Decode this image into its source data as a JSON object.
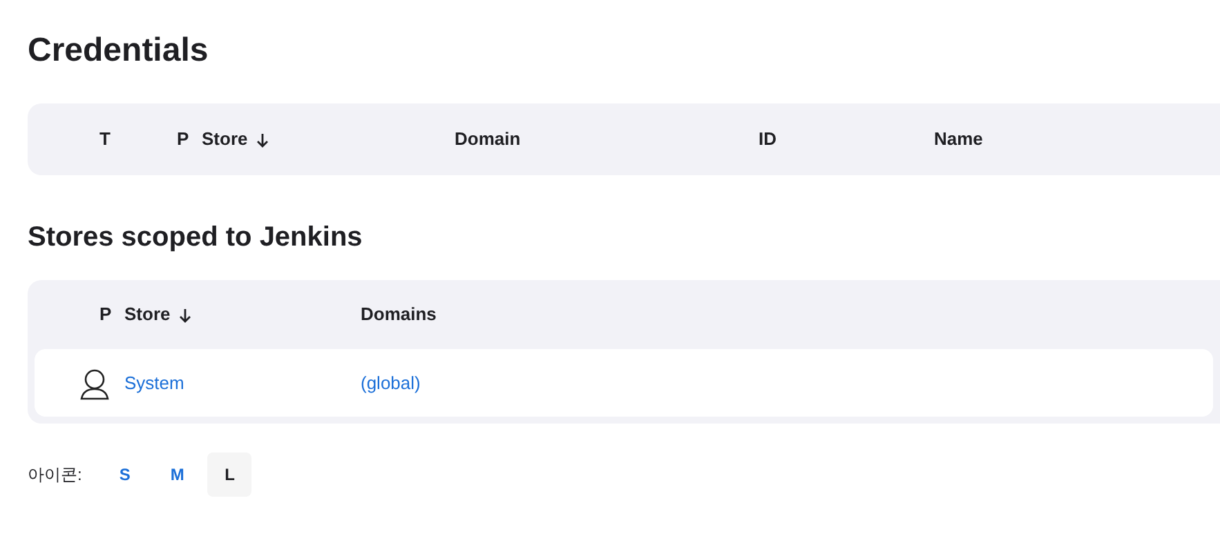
{
  "title": "Credentials",
  "credentials_table": {
    "columns": [
      {
        "label": "T",
        "sorted": false
      },
      {
        "label": "P",
        "sorted": false
      },
      {
        "label": "Store",
        "sorted": true
      },
      {
        "label": "Domain",
        "sorted": false
      },
      {
        "label": "ID",
        "sorted": false
      },
      {
        "label": "Name",
        "sorted": false
      }
    ]
  },
  "stores_heading": "Stores scoped to Jenkins",
  "stores_table": {
    "columns": [
      {
        "label": "P",
        "sorted": false
      },
      {
        "label": "Store",
        "sorted": true
      },
      {
        "label": "Domains",
        "sorted": false
      }
    ],
    "rows": [
      {
        "store": "System",
        "domain": "(global)"
      }
    ]
  },
  "icon_size": {
    "label": "아이콘:",
    "options": [
      {
        "label": "S",
        "selected": false
      },
      {
        "label": "M",
        "selected": false
      },
      {
        "label": "L",
        "selected": true
      }
    ]
  }
}
